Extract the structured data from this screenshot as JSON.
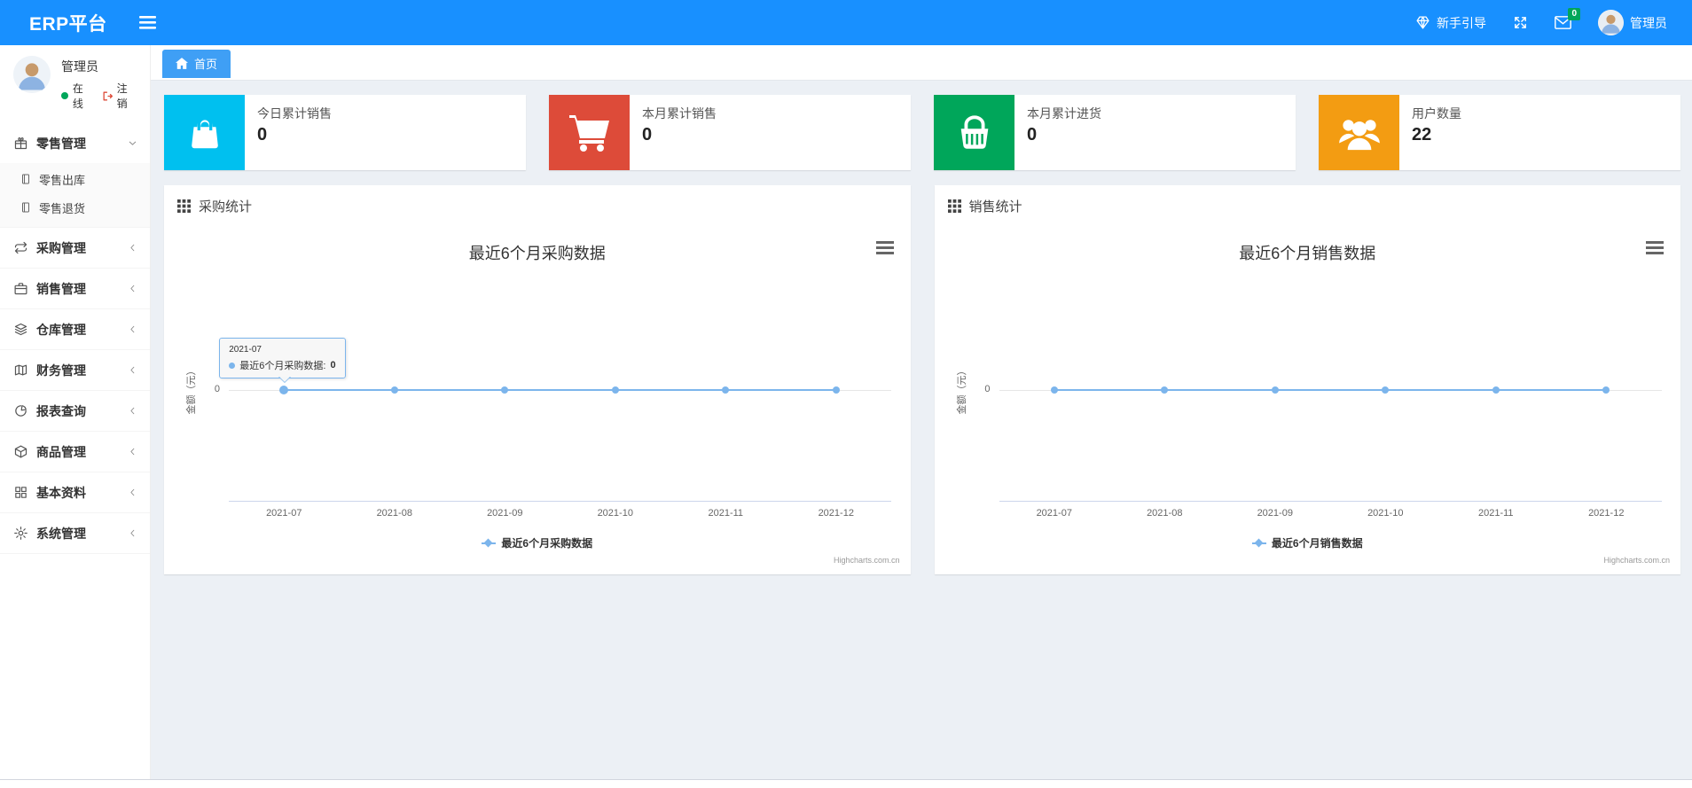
{
  "app": {
    "title": "ERP平台"
  },
  "navbar": {
    "brand": "ERP平台",
    "guide_label": "新手引导",
    "messages_badge": "0",
    "user_name": "管理员",
    "background": "#1890ff"
  },
  "sidebar": {
    "user": {
      "name": "管理员",
      "status_label": "在线",
      "logout_label": "注销"
    },
    "items": [
      {
        "name": "retail",
        "label": "零售管理",
        "icon": "gift-icon",
        "expanded": true,
        "children": [
          {
            "name": "retail-outbound",
            "label": "零售出库",
            "icon": "document-icon"
          },
          {
            "name": "retail-return",
            "label": "零售退货",
            "icon": "document-icon"
          }
        ]
      },
      {
        "name": "purchase",
        "label": "采购管理",
        "icon": "loop-icon"
      },
      {
        "name": "sales",
        "label": "销售管理",
        "icon": "briefcase-icon"
      },
      {
        "name": "warehouse",
        "label": "仓库管理",
        "icon": "layers-icon"
      },
      {
        "name": "finance",
        "label": "财务管理",
        "icon": "map-icon"
      },
      {
        "name": "report",
        "label": "报表查询",
        "icon": "pie-chart-icon"
      },
      {
        "name": "goods",
        "label": "商品管理",
        "icon": "cube-icon"
      },
      {
        "name": "basic",
        "label": "基本资料",
        "icon": "grid-icon"
      },
      {
        "name": "system",
        "label": "系统管理",
        "icon": "gear-icon"
      }
    ]
  },
  "tabbar": {
    "tabs": [
      {
        "label": "首页",
        "icon": "home-icon",
        "active": true
      }
    ]
  },
  "stat_cards": [
    {
      "label": "今日累计销售",
      "value": "0",
      "color": "#00c0ef",
      "icon": "shopping-bag-icon"
    },
    {
      "label": "本月累计销售",
      "value": "0",
      "color": "#dd4b39",
      "icon": "shopping-cart-icon"
    },
    {
      "label": "本月累计进货",
      "value": "0",
      "color": "#00a65a",
      "icon": "shopping-basket-icon"
    },
    {
      "label": "用户数量",
      "value": "22",
      "color": "#f39c12",
      "icon": "users-icon"
    }
  ],
  "panels": [
    {
      "header": "采购统计"
    },
    {
      "header": "销售统计"
    }
  ],
  "chart_data": [
    {
      "type": "line",
      "title": "最近6个月采购数据",
      "categories": [
        "2021-07",
        "2021-08",
        "2021-09",
        "2021-10",
        "2021-11",
        "2021-12"
      ],
      "series": [
        {
          "name": "最近6个月采购数据",
          "values": [
            0,
            0,
            0,
            0,
            0,
            0
          ],
          "color": "#7cb5ec"
        }
      ],
      "xlabel": "",
      "ylabel": "金额（元）",
      "y_ticks": [
        "0"
      ],
      "ylim": [
        -1,
        1
      ],
      "grid": true,
      "legend_position": "bottom",
      "credit": "Highcharts.com.cn",
      "tooltip": {
        "visible": true,
        "point_index": 0,
        "header": "2021-07",
        "series_name": "最近6个月采购数据",
        "value": "0"
      }
    },
    {
      "type": "line",
      "title": "最近6个月销售数据",
      "categories": [
        "2021-07",
        "2021-08",
        "2021-09",
        "2021-10",
        "2021-11",
        "2021-12"
      ],
      "series": [
        {
          "name": "最近6个月销售数据",
          "values": [
            0,
            0,
            0,
            0,
            0,
            0
          ],
          "color": "#7cb5ec"
        }
      ],
      "xlabel": "",
      "ylabel": "金额（元）",
      "y_ticks": [
        "0"
      ],
      "ylim": [
        -1,
        1
      ],
      "grid": true,
      "legend_position": "bottom",
      "credit": "Highcharts.com.cn",
      "tooltip": {
        "visible": false
      }
    }
  ]
}
